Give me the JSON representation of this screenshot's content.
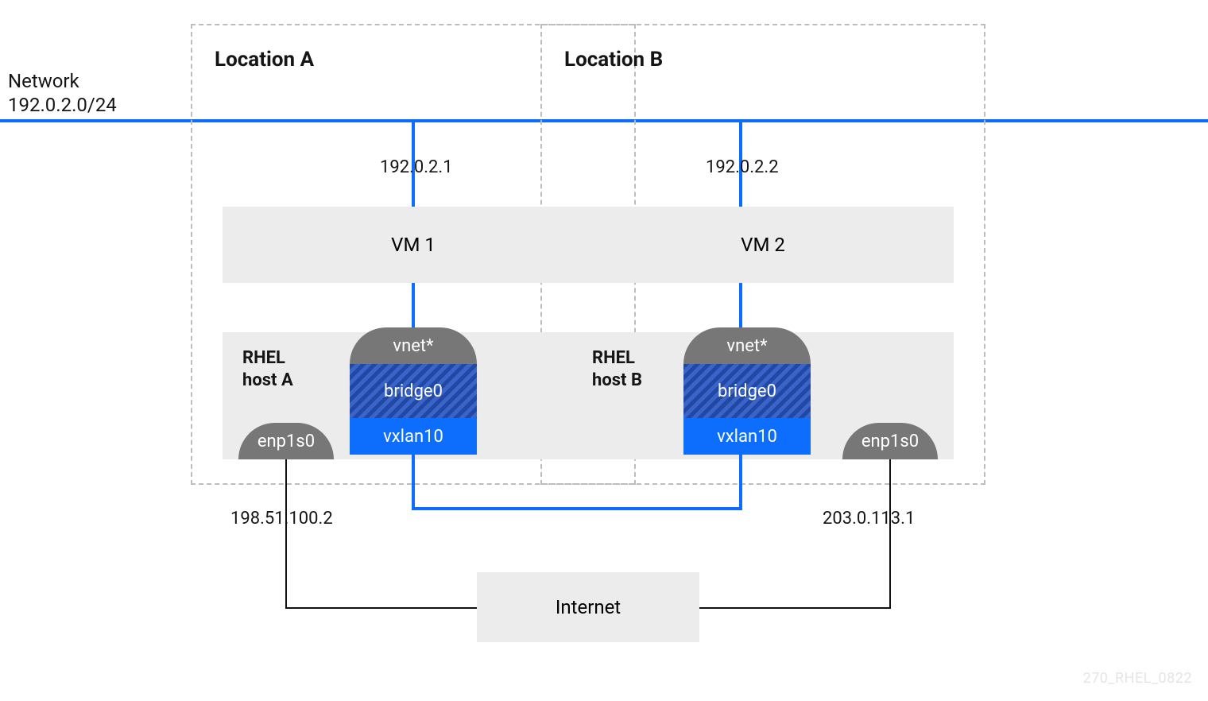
{
  "network": {
    "title": "Network",
    "cidr": "192.0.2.0/24"
  },
  "watermark": "270_RHEL_0822",
  "internet": {
    "label": "Internet"
  },
  "locations": {
    "a": {
      "title": "Location A",
      "ip": "192.0.2.1",
      "vm": "VM 1",
      "host_label1": "RHEL",
      "host_label2": "host A",
      "vnet": "vnet*",
      "bridge": "bridge0",
      "vxlan": "vxlan10",
      "nic": "enp1s0",
      "public_ip": "198.51.100.2"
    },
    "b": {
      "title": "Location B",
      "ip": "192.0.2.2",
      "vm": "VM 2",
      "host_label1": "RHEL",
      "host_label2": "host B",
      "vnet": "vnet*",
      "bridge": "bridge0",
      "vxlan": "vxlan10",
      "nic": "enp1s0",
      "public_ip": "203.0.113.1"
    }
  }
}
